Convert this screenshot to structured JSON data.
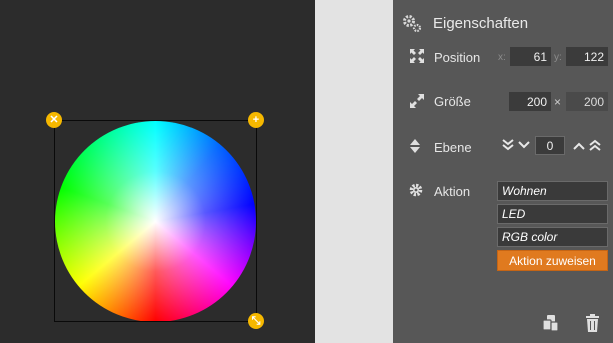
{
  "canvas": {
    "handles": {
      "close_icon": "close-icon",
      "add_icon": "plus-icon",
      "resize_icon": "resize-icon"
    },
    "widget": "color-wheel"
  },
  "panel": {
    "title": "Eigenschaften",
    "position": {
      "label": "Position",
      "x_label": "x:",
      "x_value": "61",
      "y_label": "y:",
      "y_value": "122"
    },
    "size": {
      "label": "Größe",
      "width": "200",
      "separator": "×",
      "height": "200"
    },
    "layer": {
      "label": "Ebene",
      "value": "0"
    },
    "action": {
      "label": "Aktion",
      "items": [
        "Wohnen",
        "LED",
        "RGB color"
      ],
      "assign_button": "Aktion zuweisen"
    }
  },
  "colors": {
    "accent": "#e07a1f",
    "handle": "#f6b800",
    "panel_bg": "#575757",
    "canvas_bg": "#2c2c2c"
  }
}
